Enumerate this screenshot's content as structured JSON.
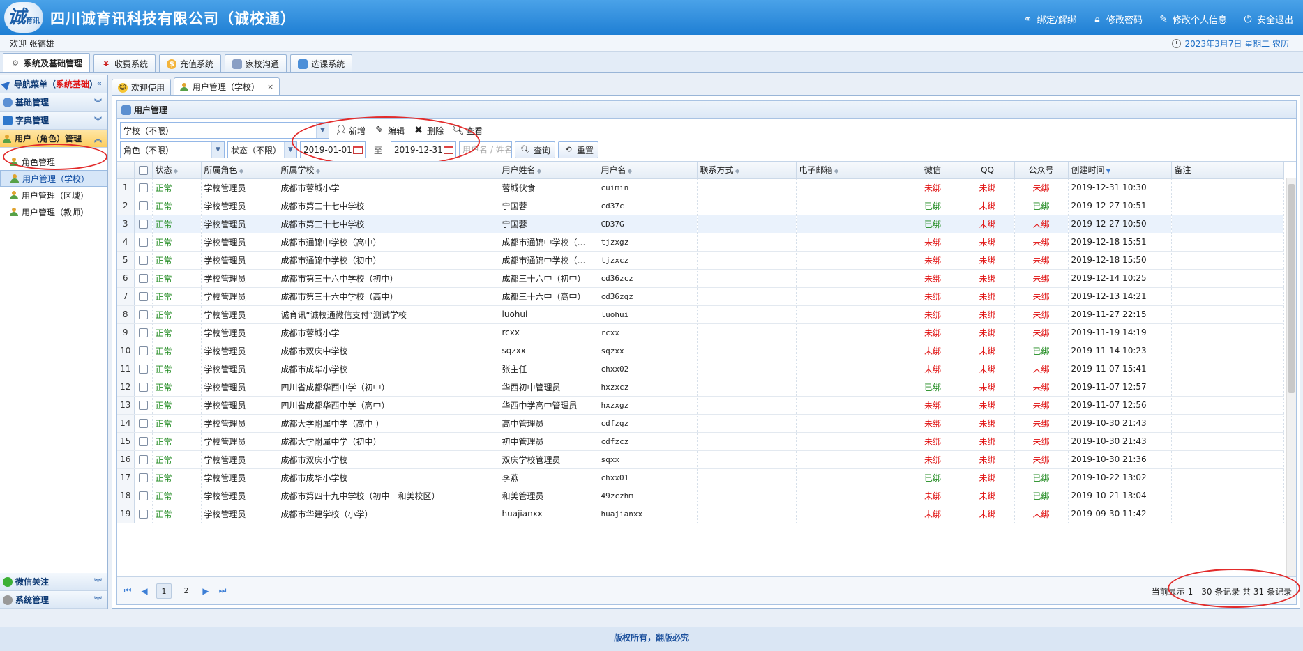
{
  "header": {
    "logo_text": "诚",
    "logo_small": "育讯",
    "title": "四川诚育讯科技有限公司（诚校通）",
    "links": [
      {
        "label": "绑定/解绑",
        "icon": "link-icon"
      },
      {
        "label": "修改密码",
        "icon": "lock-icon"
      },
      {
        "label": "修改个人信息",
        "icon": "edit-icon"
      },
      {
        "label": "安全退出",
        "icon": "power-icon"
      }
    ]
  },
  "welcome": {
    "text": "欢迎 张德雄",
    "date": "2023年3月7日 星期二 农历"
  },
  "sys_tabs": [
    {
      "label": "系统及基础管理",
      "icon": "gear-icon"
    },
    {
      "label": "收费系统",
      "icon": "yen-icon"
    },
    {
      "label": "充值系统",
      "icon": "coins-icon"
    },
    {
      "label": "家校沟通",
      "icon": "book-icon"
    },
    {
      "label": "选课系统",
      "icon": "calendar-icon"
    }
  ],
  "sidebar": {
    "nav_title": "导航菜单（",
    "nav_title_red": "系统基础",
    "nav_title_end": "）",
    "sections": [
      {
        "label": "基础管理"
      },
      {
        "label": "字典管理"
      },
      {
        "label": "用户（角色）管理"
      }
    ],
    "items": [
      {
        "label": "角色管理"
      },
      {
        "label": "用户管理（学校）"
      },
      {
        "label": "用户管理（区域）"
      },
      {
        "label": "用户管理（教师）"
      }
    ],
    "bottom_sections": [
      {
        "label": "微信关注"
      },
      {
        "label": "系统管理"
      }
    ]
  },
  "page_tabs": [
    {
      "label": "欢迎使用"
    },
    {
      "label": "用户管理（学校）"
    }
  ],
  "panel": {
    "title": "用户管理"
  },
  "toolbar": {
    "school_select": "学校（不限）",
    "add": "新增",
    "edit": "编辑",
    "delete": "删除",
    "view": "查看",
    "role_select": "角色（不限）",
    "status_select": "状态（不限）",
    "date_from": "2019-01-01",
    "date_to_label": "至",
    "date_to": "2019-12-31",
    "name_placeholder": "用户名 / 姓名",
    "query": "查询",
    "reset": "重置"
  },
  "table": {
    "headers": [
      "状态",
      "所属角色",
      "所属学校",
      "用户姓名",
      "用户名",
      "联系方式",
      "电子邮箱",
      "微信",
      "QQ",
      "公众号",
      "创建时间",
      "备注"
    ],
    "rows": [
      {
        "n": "1",
        "status": "正常",
        "role": "学校管理员",
        "school": "成都市蓉城小学",
        "name": "蓉城伙食",
        "user": "cuimin",
        "wx": "未绑",
        "qq": "未绑",
        "gzh": "未绑",
        "time": "2019-12-31 10:30"
      },
      {
        "n": "2",
        "status": "正常",
        "role": "学校管理员",
        "school": "成都市第三十七中学校",
        "name": "宁国蓉",
        "user": "cd37c",
        "wx": "已绑",
        "qq": "未绑",
        "gzh": "已绑",
        "time": "2019-12-27 10:51"
      },
      {
        "n": "3",
        "status": "正常",
        "role": "学校管理员",
        "school": "成都市第三十七中学校",
        "name": "宁国蓉",
        "user": "CD37G",
        "wx": "已绑",
        "qq": "未绑",
        "gzh": "未绑",
        "time": "2019-12-27 10:50"
      },
      {
        "n": "4",
        "status": "正常",
        "role": "学校管理员",
        "school": "成都市通锦中学校（高中）",
        "name": "成都市通锦中学校（…",
        "user": "tjzxgz",
        "wx": "未绑",
        "qq": "未绑",
        "gzh": "未绑",
        "time": "2019-12-18 15:51"
      },
      {
        "n": "5",
        "status": "正常",
        "role": "学校管理员",
        "school": "成都市通锦中学校（初中）",
        "name": "成都市通锦中学校（…",
        "user": "tjzxcz",
        "wx": "未绑",
        "qq": "未绑",
        "gzh": "未绑",
        "time": "2019-12-18 15:50"
      },
      {
        "n": "6",
        "status": "正常",
        "role": "学校管理员",
        "school": "成都市第三十六中学校（初中）",
        "name": "成都三十六中（初中）",
        "user": "cd36zcz",
        "wx": "未绑",
        "qq": "未绑",
        "gzh": "未绑",
        "time": "2019-12-14 10:25"
      },
      {
        "n": "7",
        "status": "正常",
        "role": "学校管理员",
        "school": "成都市第三十六中学校（高中）",
        "name": "成都三十六中（高中）",
        "user": "cd36zgz",
        "wx": "未绑",
        "qq": "未绑",
        "gzh": "未绑",
        "time": "2019-12-13 14:21"
      },
      {
        "n": "8",
        "status": "正常",
        "role": "学校管理员",
        "school": "诚育讯“诚校通微信支付”测试学校",
        "name": "luohui",
        "user": "luohui",
        "wx": "未绑",
        "qq": "未绑",
        "gzh": "未绑",
        "time": "2019-11-27 22:15"
      },
      {
        "n": "9",
        "status": "正常",
        "role": "学校管理员",
        "school": "成都市蓉城小学",
        "name": "rcxx",
        "user": "rcxx",
        "wx": "未绑",
        "qq": "未绑",
        "gzh": "未绑",
        "time": "2019-11-19 14:19"
      },
      {
        "n": "10",
        "status": "正常",
        "role": "学校管理员",
        "school": "成都市双庆中学校",
        "name": "sqzxx",
        "user": "sqzxx",
        "wx": "未绑",
        "qq": "未绑",
        "gzh": "已绑",
        "time": "2019-11-14 10:23"
      },
      {
        "n": "11",
        "status": "正常",
        "role": "学校管理员",
        "school": "成都市成华小学校",
        "name": "张主任",
        "user": "chxx02",
        "wx": "未绑",
        "qq": "未绑",
        "gzh": "未绑",
        "time": "2019-11-07 15:41"
      },
      {
        "n": "12",
        "status": "正常",
        "role": "学校管理员",
        "school": "四川省成都华西中学（初中）",
        "name": "华西初中管理员",
        "user": "hxzxcz",
        "wx": "已绑",
        "qq": "未绑",
        "gzh": "未绑",
        "time": "2019-11-07 12:57"
      },
      {
        "n": "13",
        "status": "正常",
        "role": "学校管理员",
        "school": "四川省成都华西中学（高中）",
        "name": "华西中学高中管理员",
        "user": "hxzxgz",
        "wx": "未绑",
        "qq": "未绑",
        "gzh": "未绑",
        "time": "2019-11-07 12:56"
      },
      {
        "n": "14",
        "status": "正常",
        "role": "学校管理员",
        "school": "成都大学附属中学（高中 ）",
        "name": "高中管理员",
        "user": "cdfzgz",
        "wx": "未绑",
        "qq": "未绑",
        "gzh": "未绑",
        "time": "2019-10-30 21:43"
      },
      {
        "n": "15",
        "status": "正常",
        "role": "学校管理员",
        "school": "成都大学附属中学（初中）",
        "name": "初中管理员",
        "user": "cdfzcz",
        "wx": "未绑",
        "qq": "未绑",
        "gzh": "未绑",
        "time": "2019-10-30 21:43"
      },
      {
        "n": "16",
        "status": "正常",
        "role": "学校管理员",
        "school": "成都市双庆小学校",
        "name": "双庆学校管理员",
        "user": "sqxx",
        "wx": "未绑",
        "qq": "未绑",
        "gzh": "未绑",
        "time": "2019-10-30 21:36"
      },
      {
        "n": "17",
        "status": "正常",
        "role": "学校管理员",
        "school": "成都市成华小学校",
        "name": "李燕",
        "user": "chxx01",
        "wx": "已绑",
        "qq": "未绑",
        "gzh": "已绑",
        "time": "2019-10-22 13:02"
      },
      {
        "n": "18",
        "status": "正常",
        "role": "学校管理员",
        "school": "成都市第四十九中学校（初中－和美校区）",
        "name": "和美管理员",
        "user": "49zczhm",
        "wx": "未绑",
        "qq": "未绑",
        "gzh": "已绑",
        "time": "2019-10-21 13:04"
      },
      {
        "n": "19",
        "status": "正常",
        "role": "学校管理员",
        "school": "成都市华建学校（小学）",
        "name": "huajianxx",
        "user": "huajianxx",
        "wx": "未绑",
        "qq": "未绑",
        "gzh": "未绑",
        "time": "2019-09-30 11:42"
      }
    ]
  },
  "pager": {
    "pages": [
      "1",
      "2"
    ],
    "info": "当前显示 1 - 30 条记录 共 31 条记录"
  },
  "footer": {
    "text": "版权所有，翻版必究"
  }
}
